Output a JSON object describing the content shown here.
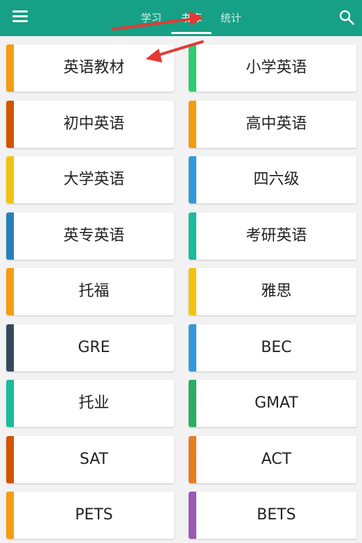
{
  "appbar": {
    "background": "#16a085",
    "menu_icon": "hamburger-menu-icon",
    "search_icon": "search-icon",
    "tabs": [
      {
        "label": "学习",
        "selected": false
      },
      {
        "label": "书库",
        "selected": true
      },
      {
        "label": "统计",
        "selected": false
      }
    ]
  },
  "library": {
    "categories": [
      {
        "label": "英语教材",
        "color": "#f39c12"
      },
      {
        "label": "小学英语",
        "color": "#2ecc71"
      },
      {
        "label": "初中英语",
        "color": "#d35400"
      },
      {
        "label": "高中英语",
        "color": "#f39c12"
      },
      {
        "label": "大学英语",
        "color": "#f1c40f"
      },
      {
        "label": "四六级",
        "color": "#3498db"
      },
      {
        "label": "英专英语",
        "color": "#2980b9"
      },
      {
        "label": "考研英语",
        "color": "#1abc9c"
      },
      {
        "label": "托福",
        "color": "#f39c12"
      },
      {
        "label": "雅思",
        "color": "#f1c40f"
      },
      {
        "label": "GRE",
        "color": "#34495e"
      },
      {
        "label": "BEC",
        "color": "#3498db"
      },
      {
        "label": "托业",
        "color": "#1abc9c"
      },
      {
        "label": "GMAT",
        "color": "#27ae60"
      },
      {
        "label": "SAT",
        "color": "#d35400"
      },
      {
        "label": "ACT",
        "color": "#e67e22"
      },
      {
        "label": "PETS",
        "color": "#f39c12"
      },
      {
        "label": "BETS",
        "color": "#9b59b6"
      }
    ]
  },
  "annotation_color": "#e53935"
}
